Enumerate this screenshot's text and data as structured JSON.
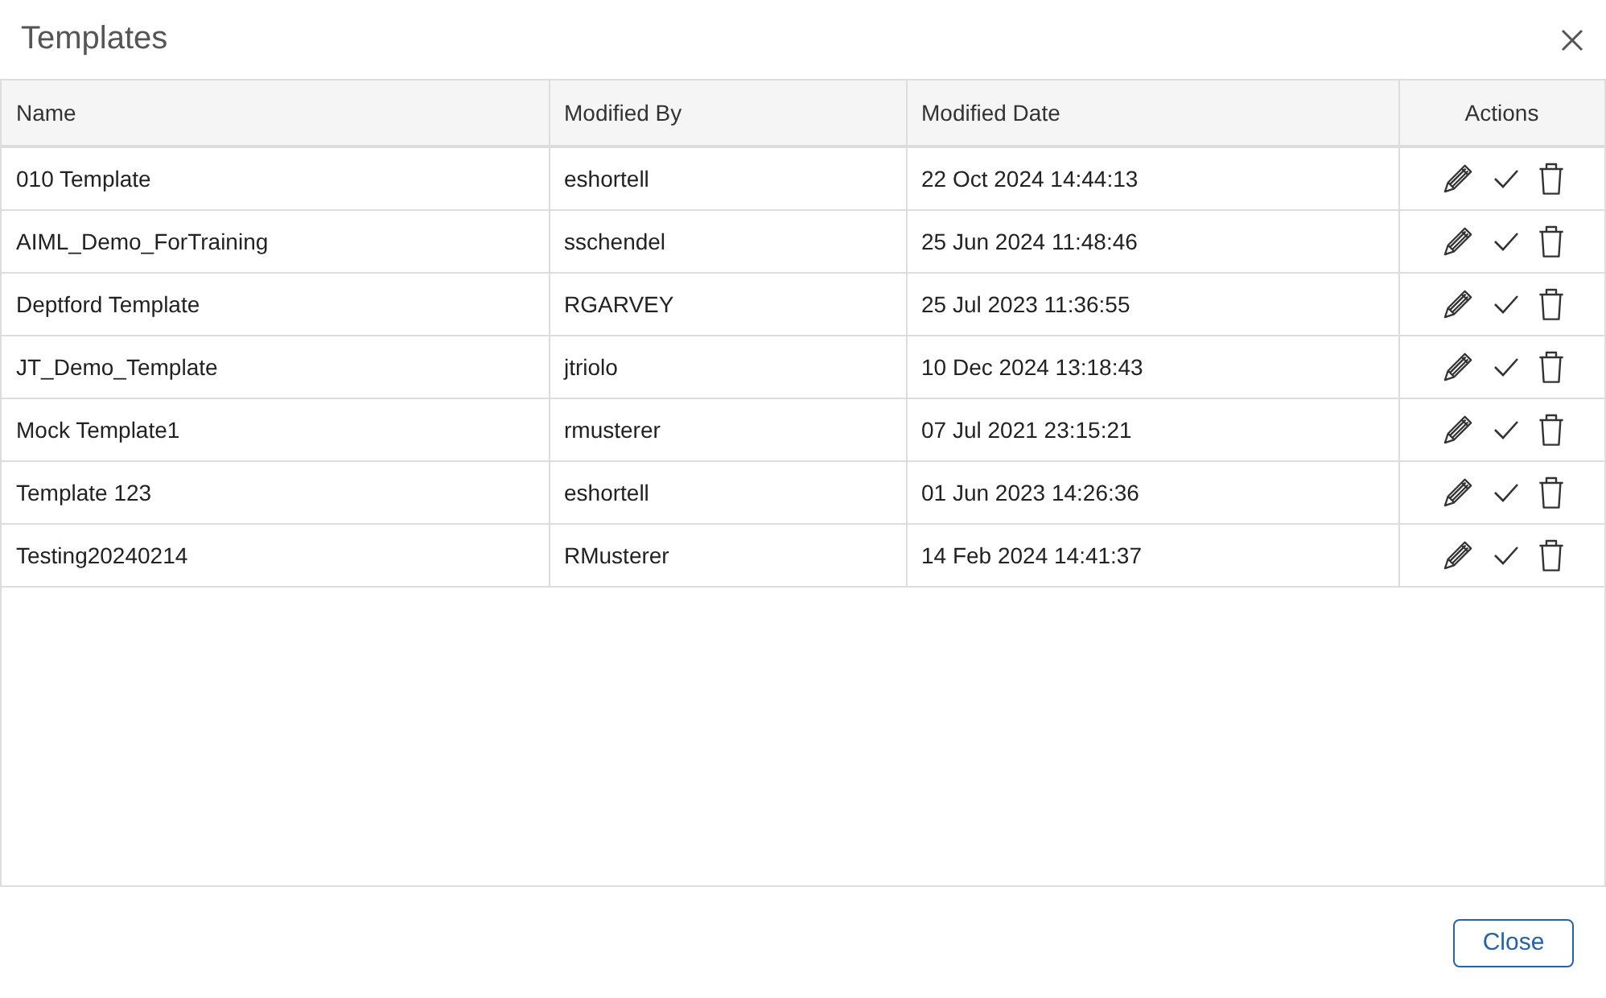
{
  "dialog": {
    "title": "Templates"
  },
  "table": {
    "columns": [
      "Name",
      "Modified By",
      "Modified Date",
      "Actions"
    ],
    "rows": [
      {
        "name": "010 Template",
        "modified_by": "eshortell",
        "modified_date": "22 Oct 2024 14:44:13"
      },
      {
        "name": "AIML_Demo_ForTraining",
        "modified_by": "sschendel",
        "modified_date": "25 Jun 2024 11:48:46"
      },
      {
        "name": "Deptford Template",
        "modified_by": "RGARVEY",
        "modified_date": "25 Jul 2023 11:36:55"
      },
      {
        "name": "JT_Demo_Template",
        "modified_by": "jtriolo",
        "modified_date": "10 Dec 2024 13:18:43"
      },
      {
        "name": "Mock Template1",
        "modified_by": "rmusterer",
        "modified_date": "07 Jul 2021 23:15:21"
      },
      {
        "name": "Template 123",
        "modified_by": "eshortell",
        "modified_date": "01 Jun 2023 14:26:36"
      },
      {
        "name": "Testing20240214",
        "modified_by": "RMusterer",
        "modified_date": "14 Feb 2024 14:41:37"
      }
    ]
  },
  "footer": {
    "buttons": [
      {
        "label": "Close"
      }
    ]
  }
}
